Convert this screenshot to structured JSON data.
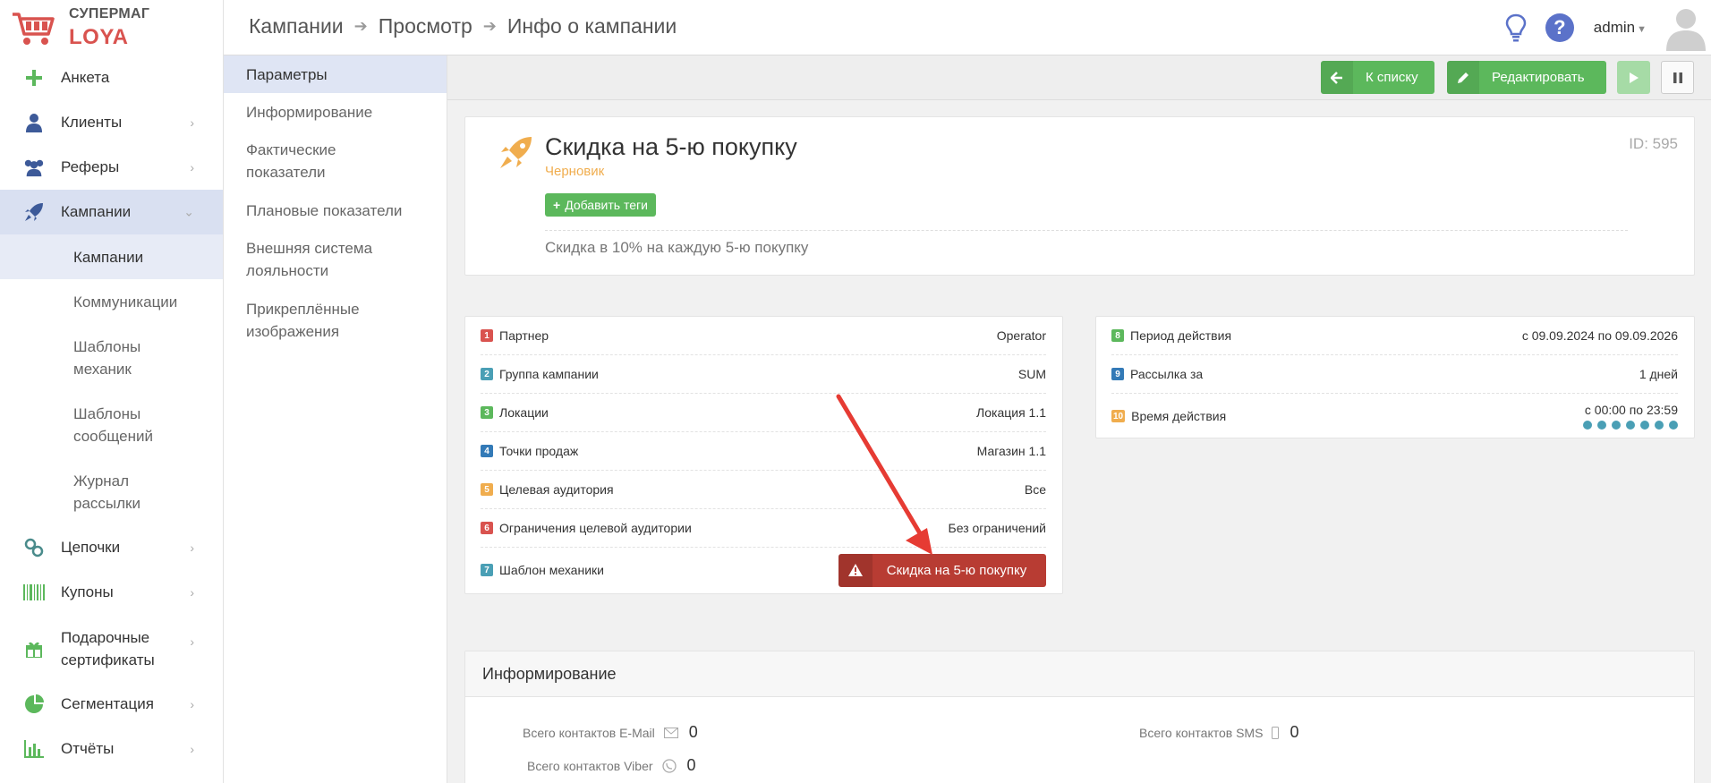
{
  "logo": {
    "top": "СУПЕРМАГ",
    "bottom": "LOYA"
  },
  "breadcrumb": [
    "Кампании",
    "Просмотр",
    "Инфо о кампании"
  ],
  "user": {
    "name": "admin"
  },
  "icons": {
    "cart": "cart-icon",
    "bulb": "lightbulb-icon",
    "help": "question-icon",
    "avatar": "avatar-icon",
    "plus": "plus-icon",
    "client": "user-icon",
    "refer": "users-icon",
    "campaign": "rocket-icon",
    "chain": "link-icon",
    "coupon": "barcode-icon",
    "gift": "gift-icon",
    "segment": "pie-icon",
    "report": "bar-chart-icon"
  },
  "sidebar": {
    "items": [
      {
        "label": "Анкета"
      },
      {
        "label": "Клиенты"
      },
      {
        "label": "Реферы"
      },
      {
        "label": "Кампании"
      },
      {
        "label": "Цепочки"
      },
      {
        "label": "Купоны"
      },
      {
        "label": "Подарочные сертификаты"
      },
      {
        "label": "Сегментация"
      },
      {
        "label": "Отчёты"
      }
    ],
    "sub": [
      {
        "label": "Кампании"
      },
      {
        "label": "Коммуникации"
      },
      {
        "label": "Шаблоны механик"
      },
      {
        "label": "Шаблоны сообщений"
      },
      {
        "label": "Журнал рассылки"
      }
    ]
  },
  "sections": [
    {
      "label": "Параметры"
    },
    {
      "label": "Информирование"
    },
    {
      "label": "Фактические показатели"
    },
    {
      "label": "Плановые показатели"
    },
    {
      "label": "Внешняя система лояльности"
    },
    {
      "label": "Прикреплённые изображения"
    }
  ],
  "toolbar": {
    "back": "К списку",
    "edit": "Редактировать"
  },
  "campaign": {
    "title": "Скидка на 5-ю покупку",
    "status": "Черновик",
    "add_tags": "Добавить теги",
    "description": "Скидка в 10% на каждую 5-ю покупку",
    "id": "ID: 595"
  },
  "params": [
    {
      "num": "1",
      "label": "Партнер",
      "value": "Operator",
      "color": "#d9534f"
    },
    {
      "num": "2",
      "label": "Группа кампании",
      "value": "SUM",
      "color": "#4a9fb5"
    },
    {
      "num": "3",
      "label": "Локации",
      "value": "Локация 1.1",
      "color": "#5cb85c"
    },
    {
      "num": "4",
      "label": "Точки продаж",
      "value": "Магазин 1.1",
      "color": "#337ab7"
    },
    {
      "num": "5",
      "label": "Целевая аудитория",
      "value": "Все",
      "color": "#f0ad4e"
    },
    {
      "num": "6",
      "label": "Ограничения целевой аудитории",
      "value": "Без ограничений",
      "color": "#d9534f"
    },
    {
      "num": "7",
      "label": "Шаблон механики",
      "value": "Скидка на 5-ю покупку",
      "color": "#4a9fb5"
    }
  ],
  "info": [
    {
      "num": "8",
      "label": "Период действия",
      "value": "с 09.09.2024 по 09.09.2026",
      "color": "#5cb85c"
    },
    {
      "num": "9",
      "label": "Рассылка за",
      "value": "1 дней",
      "color": "#337ab7"
    },
    {
      "num": "10",
      "label": "Время действия",
      "value": "с 00:00 по 23:59",
      "color": "#f0ad4e"
    }
  ],
  "notify": {
    "title": "Информирование",
    "email_label": "Всего контактов E-Mail",
    "email_value": "0",
    "sms_label": "Всего контактов SMS",
    "sms_value": "0",
    "viber_label": "Всего контактов Viber",
    "viber_value": "0"
  },
  "colors": {
    "green": "#5cb85c",
    "red": "#b83c33",
    "accent": "#d9e0f1",
    "status": "#f0ad4e"
  }
}
